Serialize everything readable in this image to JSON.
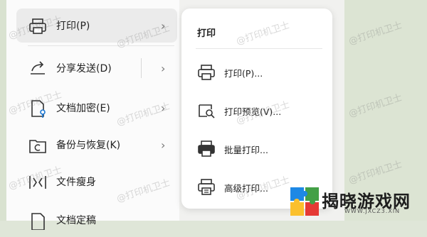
{
  "main_menu": {
    "items": [
      {
        "label": "打印(P)",
        "icon": "printer-icon",
        "has_submenu": true,
        "active": true
      },
      {
        "label": "分享发送(D)",
        "icon": "share-icon",
        "has_submenu": true
      },
      {
        "label": "文档加密(E)",
        "icon": "document-key-icon",
        "has_submenu": true
      },
      {
        "label": "备份与恢复(K)",
        "icon": "backup-restore-icon",
        "has_submenu": true
      },
      {
        "label": "文件瘦身",
        "icon": "compress-icon",
        "has_submenu": false
      },
      {
        "label": "文档定稿",
        "icon": "document-icon",
        "has_submenu": false
      }
    ]
  },
  "submenu": {
    "title": "打印",
    "items": [
      {
        "label": "打印(P)...",
        "icon": "printer-icon"
      },
      {
        "label": "打印预览(V)...",
        "icon": "print-preview-icon"
      },
      {
        "label": "批量打印...",
        "icon": "batch-print-icon"
      },
      {
        "label": "高级打印...",
        "icon": "advanced-print-icon"
      }
    ]
  },
  "watermark_text": "@打印机卫士",
  "logo": {
    "text": "揭晓游戏网",
    "subtext": "WWW.JXCZ3.XIN",
    "colors": [
      "#e53935",
      "#fbc02d",
      "#43a047",
      "#1e88e5"
    ]
  }
}
